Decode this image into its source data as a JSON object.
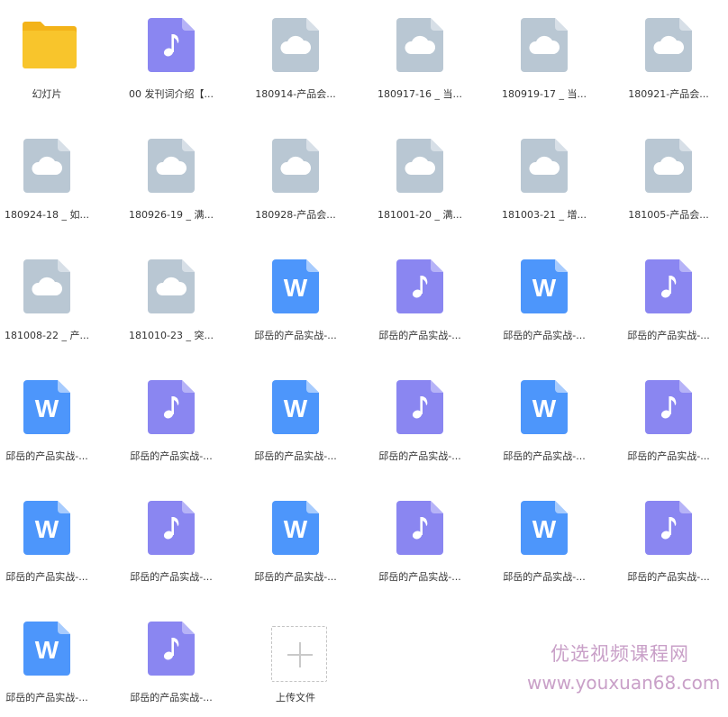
{
  "colors": {
    "folder": "#f8c52c",
    "folder_tab": "#f3b319",
    "audio": "#8a86f1",
    "audio_fold": "#b6b3f7",
    "cloud_file": "#b9c7d3",
    "cloud_fold": "#d7dfe7",
    "word": "#4d96fb",
    "word_fold": "#a7cbfd",
    "label_text": "#333333",
    "watermark": "#c9a0c8"
  },
  "files": [
    {
      "type": "folder",
      "icon": "folder-icon",
      "name": "幻灯片"
    },
    {
      "type": "audio",
      "icon": "music-note-icon",
      "name": "00 发刊词介绍【..."
    },
    {
      "type": "cloud",
      "icon": "cloud-file-icon",
      "name": "180914-产品会..."
    },
    {
      "type": "cloud",
      "icon": "cloud-file-icon",
      "name": "180917-16 _ 当..."
    },
    {
      "type": "cloud",
      "icon": "cloud-file-icon",
      "name": "180919-17 _ 当..."
    },
    {
      "type": "cloud",
      "icon": "cloud-file-icon",
      "name": "180921-产品会..."
    },
    {
      "type": "cloud",
      "icon": "cloud-file-icon",
      "name": "180924-18 _ 如..."
    },
    {
      "type": "cloud",
      "icon": "cloud-file-icon",
      "name": "180926-19 _ 满..."
    },
    {
      "type": "cloud",
      "icon": "cloud-file-icon",
      "name": "180928-产品会..."
    },
    {
      "type": "cloud",
      "icon": "cloud-file-icon",
      "name": "181001-20 _ 满..."
    },
    {
      "type": "cloud",
      "icon": "cloud-file-icon",
      "name": "181003-21 _ 增..."
    },
    {
      "type": "cloud",
      "icon": "cloud-file-icon",
      "name": "181005-产品会..."
    },
    {
      "type": "cloud",
      "icon": "cloud-file-icon",
      "name": "181008-22 _ 产..."
    },
    {
      "type": "cloud",
      "icon": "cloud-file-icon",
      "name": "181010-23 _ 突..."
    },
    {
      "type": "word",
      "icon": "word-doc-icon",
      "name": "邱岳的产品实战-..."
    },
    {
      "type": "audio",
      "icon": "music-note-icon",
      "name": "邱岳的产品实战-..."
    },
    {
      "type": "word",
      "icon": "word-doc-icon",
      "name": "邱岳的产品实战-..."
    },
    {
      "type": "audio",
      "icon": "music-note-icon",
      "name": "邱岳的产品实战-..."
    },
    {
      "type": "word",
      "icon": "word-doc-icon",
      "name": "邱岳的产品实战-..."
    },
    {
      "type": "audio",
      "icon": "music-note-icon",
      "name": "邱岳的产品实战-..."
    },
    {
      "type": "word",
      "icon": "word-doc-icon",
      "name": "邱岳的产品实战-..."
    },
    {
      "type": "audio",
      "icon": "music-note-icon",
      "name": "邱岳的产品实战-..."
    },
    {
      "type": "word",
      "icon": "word-doc-icon",
      "name": "邱岳的产品实战-..."
    },
    {
      "type": "audio",
      "icon": "music-note-icon",
      "name": "邱岳的产品实战-..."
    },
    {
      "type": "word",
      "icon": "word-doc-icon",
      "name": "邱岳的产品实战-..."
    },
    {
      "type": "audio",
      "icon": "music-note-icon",
      "name": "邱岳的产品实战-..."
    },
    {
      "type": "word",
      "icon": "word-doc-icon",
      "name": "邱岳的产品实战-..."
    },
    {
      "type": "audio",
      "icon": "music-note-icon",
      "name": "邱岳的产品实战-..."
    },
    {
      "type": "word",
      "icon": "word-doc-icon",
      "name": "邱岳的产品实战-..."
    },
    {
      "type": "audio",
      "icon": "music-note-icon",
      "name": "邱岳的产品实战-..."
    },
    {
      "type": "word",
      "icon": "word-doc-icon",
      "name": "邱岳的产品实战-..."
    },
    {
      "type": "audio",
      "icon": "music-note-icon",
      "name": "邱岳的产品实战-..."
    },
    {
      "type": "upload",
      "icon": "plus-icon",
      "name": "上传文件"
    }
  ],
  "word_letter": "W",
  "watermark": {
    "cn": "优选视频课程网",
    "url": "www.youxuan68.com"
  }
}
